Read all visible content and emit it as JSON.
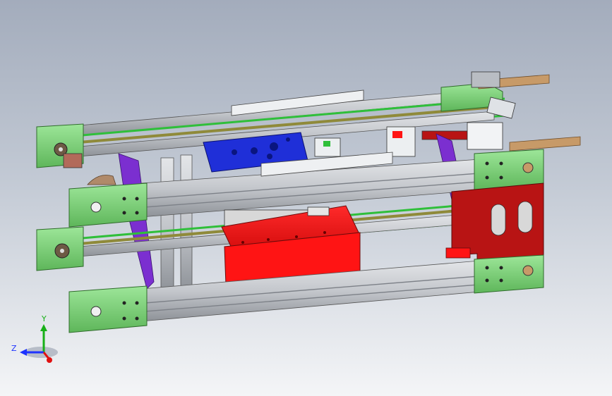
{
  "viewport": {
    "background_top": "#a3acbc",
    "background_bottom": "#f4f5f7"
  },
  "model": {
    "colors": {
      "frame_green": "#7fd67a",
      "frame_green_dark": "#3f8f3a",
      "rail_gray": "#c9ccd1",
      "rail_dark": "#7d8188",
      "belt_green": "#2fbf3a",
      "belt_olive": "#8f8a3a",
      "plate_blue": "#1f2fd8",
      "block_red": "#ff1414",
      "plate_red_dark": "#b81414",
      "bracket_purple": "#7b2fd0",
      "bar_bronze": "#c79a68",
      "sensor_white": "#eceff1"
    }
  },
  "triad": {
    "x_label": "",
    "y_label": "Y",
    "z_label": "Z",
    "x_color": "#e01010",
    "y_color": "#18b018",
    "z_color": "#1e33ff"
  }
}
